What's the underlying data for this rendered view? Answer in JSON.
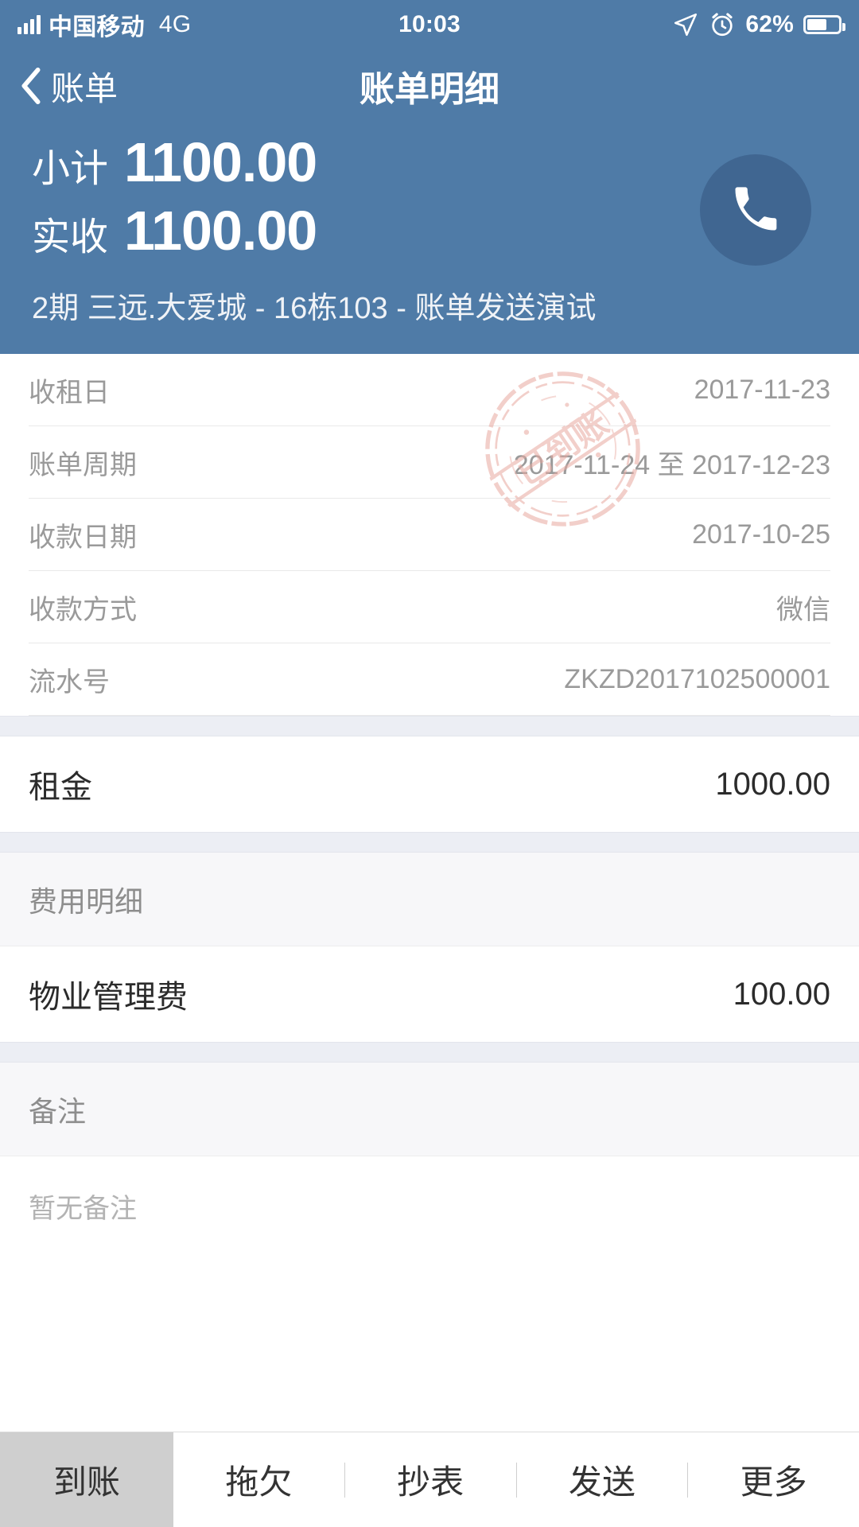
{
  "status_bar": {
    "carrier": "中国移动",
    "network": "4G",
    "time": "10:03",
    "battery_percent": "62%",
    "battery_level": 62,
    "icons": [
      "signal-bars-icon",
      "location-arrow-icon",
      "alarm-clock-icon",
      "battery-icon"
    ]
  },
  "nav": {
    "back_label": "账单",
    "title": "账单明细"
  },
  "summary": {
    "subtotal_label": "小计",
    "subtotal_value": "1100.00",
    "received_label": "实收",
    "received_value": "1100.00",
    "address": "2期 三远.大爱城 - 16栋103 - 账单发送演试",
    "call_button": "call-icon"
  },
  "stamp": {
    "text": "已到账",
    "color": "#e8a9a0"
  },
  "info_rows": [
    {
      "label": "收租日",
      "value": "2017-11-23"
    },
    {
      "label": "账单周期",
      "value": "2017-11-24 至 2017-12-23"
    },
    {
      "label": "收款日期",
      "value": "2017-10-25"
    },
    {
      "label": "收款方式",
      "value": "微信"
    },
    {
      "label": "流水号",
      "value": "ZKZD2017102500001"
    }
  ],
  "rent": {
    "name": "租金",
    "amount": "1000.00"
  },
  "fee_section": {
    "title": "费用明细",
    "items": [
      {
        "name": "物业管理费",
        "amount": "100.00"
      }
    ]
  },
  "remark_section": {
    "title": "备注",
    "content": "暂无备注"
  },
  "toolbar": {
    "active": "到账",
    "items": [
      "拖欠",
      "抄表",
      "发送",
      "更多"
    ]
  },
  "colors": {
    "header_blue": "#4f7ba7",
    "call_button": "#406691",
    "divider": "#eceef4",
    "stamp_red": "#e8a9a0"
  }
}
